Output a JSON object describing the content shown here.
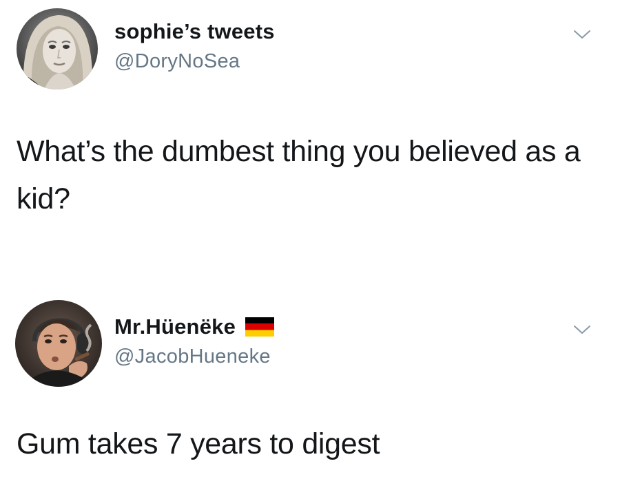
{
  "tweets": [
    {
      "display_name": "sophie’s tweets",
      "handle": "@DoryNoSea",
      "text": "What’s the dumbest thing you believed as a kid?",
      "avatar_icon": "profile-photo",
      "menu_icon": "chevron-down-icon"
    },
    {
      "display_name": "Mr.Hüenëke",
      "handle": "@JacobHueneke",
      "text": "Gum takes 7 years to digest",
      "badge_icon": "german-flag-icon",
      "avatar_icon": "profile-photo",
      "menu_icon": "chevron-down-icon"
    }
  ],
  "colors": {
    "text_primary": "#14171a",
    "text_secondary": "#657786",
    "caret": "#8899a6",
    "background": "#ffffff"
  }
}
